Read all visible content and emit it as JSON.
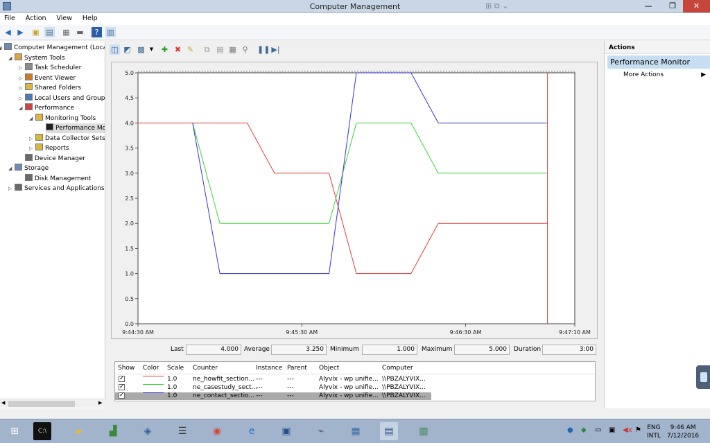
{
  "window": {
    "title": "Computer Management",
    "min": "—",
    "max": "❐",
    "close": "✕"
  },
  "menu": [
    "File",
    "Action",
    "View",
    "Help"
  ],
  "tree": [
    {
      "label": "Computer Management (Local",
      "level": 0,
      "arrow": "◢"
    },
    {
      "label": "System Tools",
      "level": 1,
      "arrow": "◢"
    },
    {
      "label": "Task Scheduler",
      "level": 2,
      "arrow": "▷"
    },
    {
      "label": "Event Viewer",
      "level": 2,
      "arrow": "▷"
    },
    {
      "label": "Shared Folders",
      "level": 2,
      "arrow": "▷"
    },
    {
      "label": "Local Users and Groups",
      "level": 2,
      "arrow": "▷"
    },
    {
      "label": "Performance",
      "level": 2,
      "arrow": "◢"
    },
    {
      "label": "Monitoring Tools",
      "level": 3,
      "arrow": "◢"
    },
    {
      "label": "Performance Mo",
      "level": 4,
      "arrow": ""
    },
    {
      "label": "Data Collector Sets",
      "level": 3,
      "arrow": "▷"
    },
    {
      "label": "Reports",
      "level": 3,
      "arrow": "▷"
    },
    {
      "label": "Device Manager",
      "level": 2,
      "arrow": ""
    },
    {
      "label": "Storage",
      "level": 1,
      "arrow": "◢"
    },
    {
      "label": "Disk Management",
      "level": 2,
      "arrow": ""
    },
    {
      "label": "Services and Applications",
      "level": 1,
      "arrow": "▷"
    }
  ],
  "chart_data": {
    "type": "line",
    "xlim": [
      "9:44:30 AM",
      "9:47:10 AM"
    ],
    "x_ticks": [
      "9:44:30 AM",
      "9:45:30 AM",
      "9:46:30 AM",
      "9:47:10 AM"
    ],
    "ylim": [
      0,
      5
    ],
    "y_ticks": [
      "0.0",
      "0.5",
      "1.0",
      "1.5",
      "2.0",
      "2.5",
      "3.0",
      "3.5",
      "4.0",
      "4.5",
      "5.0"
    ],
    "grid": false,
    "cursor_x_seconds": 150,
    "series": [
      {
        "name": "ne_howfit_section...",
        "color": "#e03a3a",
        "points": [
          [
            0,
            4
          ],
          [
            40,
            4
          ],
          [
            50,
            3
          ],
          [
            70,
            3
          ],
          [
            80,
            1
          ],
          [
            100,
            1
          ],
          [
            110,
            2
          ],
          [
            150,
            2
          ]
        ]
      },
      {
        "name": "ne_casestudy_sect...",
        "color": "#39d339",
        "points": [
          [
            20,
            4
          ],
          [
            30,
            2
          ],
          [
            70,
            2
          ],
          [
            80,
            4
          ],
          [
            100,
            4
          ],
          [
            110,
            3
          ],
          [
            150,
            3
          ]
        ]
      },
      {
        "name": "ne_contact_sectio...",
        "color": "#3333d6",
        "points": [
          [
            20,
            4
          ],
          [
            30,
            1
          ],
          [
            70,
            1
          ],
          [
            80,
            5
          ],
          [
            100,
            5
          ],
          [
            110,
            4
          ],
          [
            150,
            4
          ]
        ]
      }
    ]
  },
  "stats": {
    "last_label": "Last",
    "last": "4.000",
    "avg_label": "Average",
    "avg": "3.250",
    "min_label": "Minimum",
    "min": "1.000",
    "max_label": "Maximum",
    "max": "5.000",
    "dur_label": "Duration",
    "dur": "3:00"
  },
  "legend": {
    "headers": [
      "Show",
      "Color",
      "Scale",
      "Counter",
      "Instance",
      "Parent",
      "Object",
      "Computer"
    ],
    "rows": [
      {
        "color": "#e03a3a",
        "scale": "1.0",
        "counter": "ne_howfit_section...",
        "instance": "---",
        "parent": "---",
        "object": "Alyvix - wp unifie...",
        "computer": "\\\\PBZALYVIX..."
      },
      {
        "color": "#39d339",
        "scale": "1.0",
        "counter": "ne_casestudy_sect...",
        "instance": "---",
        "parent": "---",
        "object": "Alyvix - wp unifie...",
        "computer": "\\\\PBZALYVIX..."
      },
      {
        "color": "#3333d6",
        "scale": "1.0",
        "counter": "ne_contact_sectio...",
        "instance": "---",
        "parent": "---",
        "object": "Alyvix - wp unifie...",
        "computer": "\\\\PBZALYVIX..."
      }
    ]
  },
  "actions": {
    "header": "Actions",
    "selected": "Performance Monitor",
    "more": "More Actions"
  },
  "tray": {
    "lang1": "ENG",
    "lang2": "INTL",
    "time": "9:46 AM",
    "date": "7/12/2016"
  }
}
